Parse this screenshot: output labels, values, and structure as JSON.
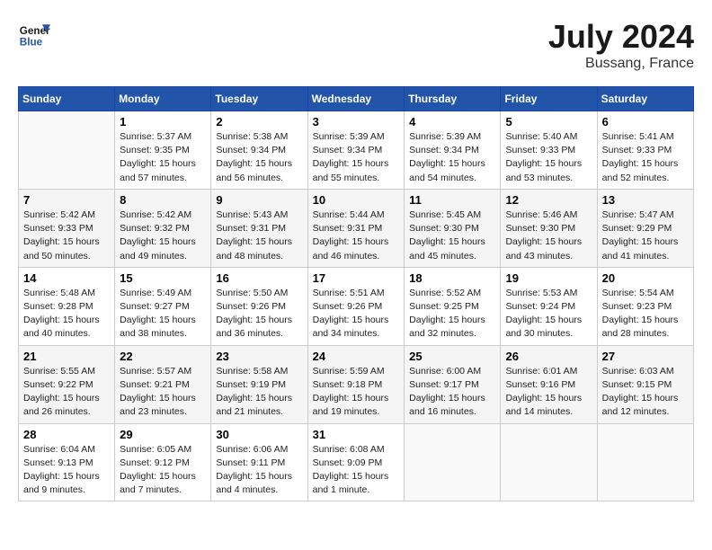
{
  "header": {
    "logo_general": "General",
    "logo_blue": "Blue",
    "title": "July 2024",
    "subtitle": "Bussang, France"
  },
  "columns": [
    "Sunday",
    "Monday",
    "Tuesday",
    "Wednesday",
    "Thursday",
    "Friday",
    "Saturday"
  ],
  "weeks": [
    {
      "shade": false,
      "days": [
        {
          "num": "",
          "info": ""
        },
        {
          "num": "1",
          "info": "Sunrise: 5:37 AM\nSunset: 9:35 PM\nDaylight: 15 hours\nand 57 minutes."
        },
        {
          "num": "2",
          "info": "Sunrise: 5:38 AM\nSunset: 9:34 PM\nDaylight: 15 hours\nand 56 minutes."
        },
        {
          "num": "3",
          "info": "Sunrise: 5:39 AM\nSunset: 9:34 PM\nDaylight: 15 hours\nand 55 minutes."
        },
        {
          "num": "4",
          "info": "Sunrise: 5:39 AM\nSunset: 9:34 PM\nDaylight: 15 hours\nand 54 minutes."
        },
        {
          "num": "5",
          "info": "Sunrise: 5:40 AM\nSunset: 9:33 PM\nDaylight: 15 hours\nand 53 minutes."
        },
        {
          "num": "6",
          "info": "Sunrise: 5:41 AM\nSunset: 9:33 PM\nDaylight: 15 hours\nand 52 minutes."
        }
      ]
    },
    {
      "shade": true,
      "days": [
        {
          "num": "7",
          "info": "Sunrise: 5:42 AM\nSunset: 9:33 PM\nDaylight: 15 hours\nand 50 minutes."
        },
        {
          "num": "8",
          "info": "Sunrise: 5:42 AM\nSunset: 9:32 PM\nDaylight: 15 hours\nand 49 minutes."
        },
        {
          "num": "9",
          "info": "Sunrise: 5:43 AM\nSunset: 9:31 PM\nDaylight: 15 hours\nand 48 minutes."
        },
        {
          "num": "10",
          "info": "Sunrise: 5:44 AM\nSunset: 9:31 PM\nDaylight: 15 hours\nand 46 minutes."
        },
        {
          "num": "11",
          "info": "Sunrise: 5:45 AM\nSunset: 9:30 PM\nDaylight: 15 hours\nand 45 minutes."
        },
        {
          "num": "12",
          "info": "Sunrise: 5:46 AM\nSunset: 9:30 PM\nDaylight: 15 hours\nand 43 minutes."
        },
        {
          "num": "13",
          "info": "Sunrise: 5:47 AM\nSunset: 9:29 PM\nDaylight: 15 hours\nand 41 minutes."
        }
      ]
    },
    {
      "shade": false,
      "days": [
        {
          "num": "14",
          "info": "Sunrise: 5:48 AM\nSunset: 9:28 PM\nDaylight: 15 hours\nand 40 minutes."
        },
        {
          "num": "15",
          "info": "Sunrise: 5:49 AM\nSunset: 9:27 PM\nDaylight: 15 hours\nand 38 minutes."
        },
        {
          "num": "16",
          "info": "Sunrise: 5:50 AM\nSunset: 9:26 PM\nDaylight: 15 hours\nand 36 minutes."
        },
        {
          "num": "17",
          "info": "Sunrise: 5:51 AM\nSunset: 9:26 PM\nDaylight: 15 hours\nand 34 minutes."
        },
        {
          "num": "18",
          "info": "Sunrise: 5:52 AM\nSunset: 9:25 PM\nDaylight: 15 hours\nand 32 minutes."
        },
        {
          "num": "19",
          "info": "Sunrise: 5:53 AM\nSunset: 9:24 PM\nDaylight: 15 hours\nand 30 minutes."
        },
        {
          "num": "20",
          "info": "Sunrise: 5:54 AM\nSunset: 9:23 PM\nDaylight: 15 hours\nand 28 minutes."
        }
      ]
    },
    {
      "shade": true,
      "days": [
        {
          "num": "21",
          "info": "Sunrise: 5:55 AM\nSunset: 9:22 PM\nDaylight: 15 hours\nand 26 minutes."
        },
        {
          "num": "22",
          "info": "Sunrise: 5:57 AM\nSunset: 9:21 PM\nDaylight: 15 hours\nand 23 minutes."
        },
        {
          "num": "23",
          "info": "Sunrise: 5:58 AM\nSunset: 9:19 PM\nDaylight: 15 hours\nand 21 minutes."
        },
        {
          "num": "24",
          "info": "Sunrise: 5:59 AM\nSunset: 9:18 PM\nDaylight: 15 hours\nand 19 minutes."
        },
        {
          "num": "25",
          "info": "Sunrise: 6:00 AM\nSunset: 9:17 PM\nDaylight: 15 hours\nand 16 minutes."
        },
        {
          "num": "26",
          "info": "Sunrise: 6:01 AM\nSunset: 9:16 PM\nDaylight: 15 hours\nand 14 minutes."
        },
        {
          "num": "27",
          "info": "Sunrise: 6:03 AM\nSunset: 9:15 PM\nDaylight: 15 hours\nand 12 minutes."
        }
      ]
    },
    {
      "shade": false,
      "days": [
        {
          "num": "28",
          "info": "Sunrise: 6:04 AM\nSunset: 9:13 PM\nDaylight: 15 hours\nand 9 minutes."
        },
        {
          "num": "29",
          "info": "Sunrise: 6:05 AM\nSunset: 9:12 PM\nDaylight: 15 hours\nand 7 minutes."
        },
        {
          "num": "30",
          "info": "Sunrise: 6:06 AM\nSunset: 9:11 PM\nDaylight: 15 hours\nand 4 minutes."
        },
        {
          "num": "31",
          "info": "Sunrise: 6:08 AM\nSunset: 9:09 PM\nDaylight: 15 hours\nand 1 minute."
        },
        {
          "num": "",
          "info": ""
        },
        {
          "num": "",
          "info": ""
        },
        {
          "num": "",
          "info": ""
        }
      ]
    }
  ]
}
